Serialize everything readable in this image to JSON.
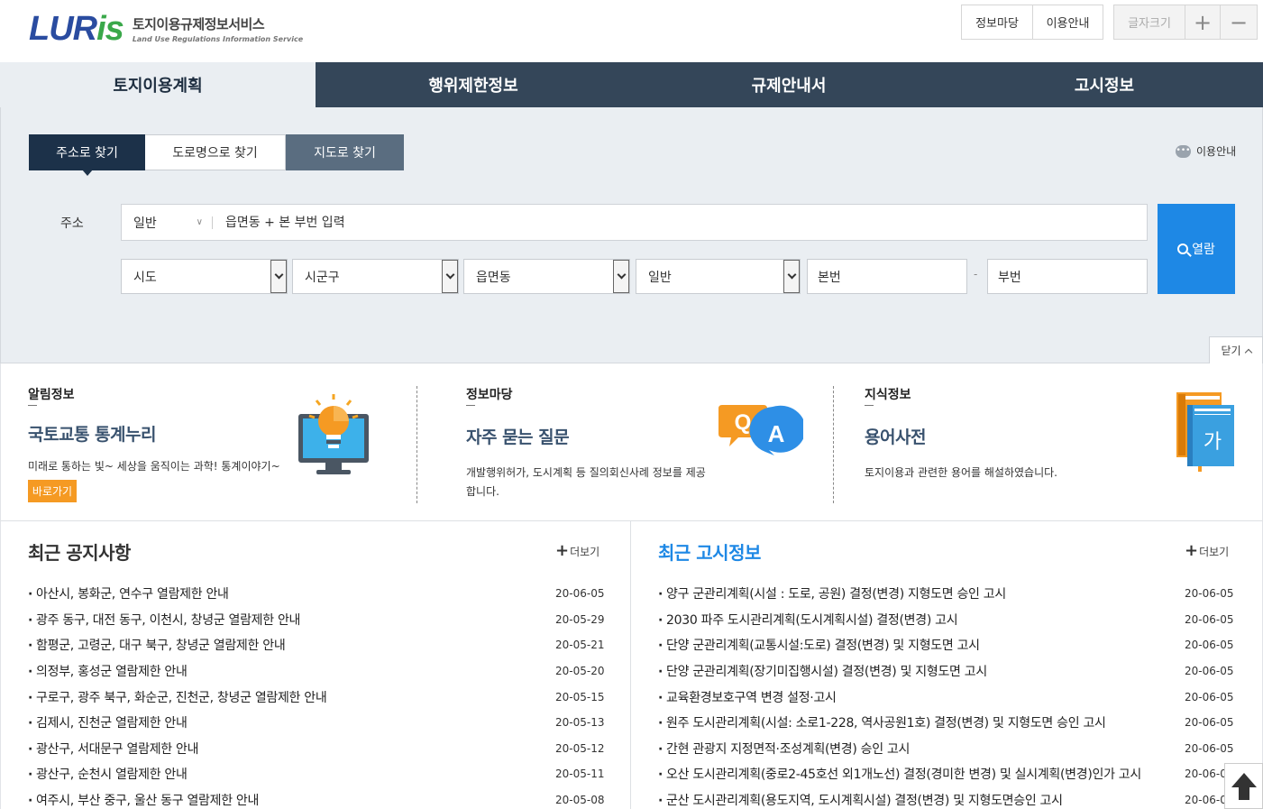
{
  "header": {
    "logo_mark_a": "LUR",
    "logo_mark_b": "is",
    "logo_title": "토지이용규제정보서비스",
    "logo_subtitle": "Land Use Regulations Information Service",
    "info_yard": "정보마당",
    "usage": "이용안내",
    "font_size": "글자크기",
    "font_plus": "+",
    "font_minus": "−"
  },
  "main_tabs": [
    "토지이용계획",
    "행위제한정보",
    "규제안내서",
    "고시정보"
  ],
  "search": {
    "sub_tabs": [
      "주소로 찾기",
      "도로명으로 찾기",
      "지도로 찾기"
    ],
    "usage_guide": "이용안내",
    "address_label": "주소",
    "address_type": "일반",
    "address_placeholder": "읍면동 + 본 부번 입력",
    "view_button": "열람",
    "sido": "시도",
    "sigungu": "시군구",
    "eupmyeondong": "읍면동",
    "land_type": "일반",
    "main_number": "본번",
    "dash": "-",
    "sub_number": "부번",
    "close": "닫기"
  },
  "info": {
    "notice": {
      "category": "알림정보",
      "title": "국토교통 통계누리",
      "desc": "미래로 통하는 빛~ 세상을 움직이는 과학! 통계이야기~",
      "go": "바로가기"
    },
    "board": {
      "category": "정보마당",
      "title": "자주 묻는 질문",
      "desc": "개발행위허가, 도시계획 등 질의회신사례 정보를 제공합니다."
    },
    "knowledge": {
      "category": "지식정보",
      "title": "용어사전",
      "desc": "토지이용과 관련한 용어를 해설하였습니다."
    },
    "qa_q": "Q",
    "qa_a": "A",
    "book_char": "가"
  },
  "notices": {
    "heading": "최근 공지사항",
    "more": "더보기",
    "items": [
      {
        "title": "아산시, 봉화군, 연수구 열람제한 안내",
        "date": "20-06-05"
      },
      {
        "title": "광주 동구, 대전 동구, 이천시, 창녕군 열람제한 안내",
        "date": "20-05-29"
      },
      {
        "title": "함평군, 고령군, 대구 북구, 창녕군 열람제한 안내",
        "date": "20-05-21"
      },
      {
        "title": "의정부, 홍성군 열람제한 안내",
        "date": "20-05-20"
      },
      {
        "title": "구로구, 광주 북구, 화순군, 진천군, 창녕군 열람제한 안내",
        "date": "20-05-15"
      },
      {
        "title": "김제시, 진천군 열람제한 안내",
        "date": "20-05-13"
      },
      {
        "title": "광산구, 서대문구 열람제한 안내",
        "date": "20-05-12"
      },
      {
        "title": "광산구, 순천시 열람제한 안내",
        "date": "20-05-11"
      },
      {
        "title": "여주시, 부산 중구, 울산 동구 열람제한 안내",
        "date": "20-05-08"
      }
    ]
  },
  "gosi": {
    "heading": "최근 고시정보",
    "more": "더보기",
    "items": [
      {
        "title": "양구 군관리계획(시설 : 도로, 공원) 결정(변경) 지형도면 승인 고시",
        "date": "20-06-05"
      },
      {
        "title": "2030 파주 도시관리계획(도시계획시설) 결정(변경) 고시",
        "date": "20-06-05"
      },
      {
        "title": "단양 군관리계획(교통시설:도로) 결정(변경) 및 지형도면 고시",
        "date": "20-06-05"
      },
      {
        "title": "단양 군관리계획(장기미집행시설) 결정(변경) 및 지형도면 고시",
        "date": "20-06-05"
      },
      {
        "title": "교육환경보호구역 변경 설정·고시",
        "date": "20-06-05"
      },
      {
        "title": "원주 도시관리계획(시설: 소로1-228, 역사공원1호) 결정(변경) 및 지형도면 승인 고시",
        "date": "20-06-05"
      },
      {
        "title": "간현 관광지 지정면적·조성계획(변경) 승인 고시",
        "date": "20-06-05"
      },
      {
        "title": "오산 도시관리계획(중로2-45호선 외1개노선) 결정(경미한 변경) 및 실시계획(변경)인가 고시",
        "date": "20-06-05"
      },
      {
        "title": "군산 도시관리계획(용도지역, 도시계획시설) 결정(변경) 및 지형도면승인 고시",
        "date": "20-06-05"
      }
    ]
  }
}
